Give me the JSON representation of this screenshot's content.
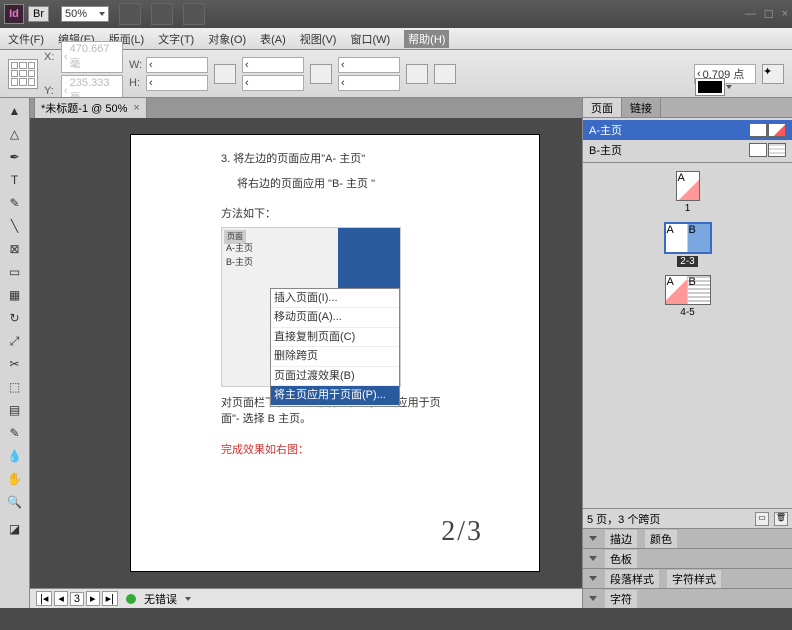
{
  "titlebar": {
    "app_abbr": "Id",
    "bridge": "Br",
    "zoom": "50%"
  },
  "menu": {
    "file": "文件(F)",
    "edit": "编辑(E)",
    "layout": "版面(L)",
    "type": "文字(T)",
    "object": "对象(O)",
    "table": "表(A)",
    "view": "视图(V)",
    "window": "窗口(W)",
    "help": "帮助(H)"
  },
  "ctrl": {
    "x_label": "X:",
    "y_label": "Y:",
    "w_label": "W:",
    "h_label": "H:",
    "x": "470.667 毫",
    "y": "235.333 毫",
    "stroke": "0.709 点"
  },
  "tab": {
    "name": "*未标题-1 @ 50%"
  },
  "doc": {
    "step_num": "3.",
    "step_line1": "将左边的页面应用\"A- 主页\"",
    "step_line2": "将右边的页面应用 \"B- 主页 \"",
    "method": "方法如下：",
    "desc1": "对页面栏下右边的页面右击 -\"将主页应用于页",
    "desc2": "面\"- 选择 B 主页。",
    "result": "完成效果如右图：",
    "pagenum": "2/3",
    "ss": {
      "a": "A-主页",
      "b": "B-主页",
      "m1": "插入页面(I)...",
      "m2": "移动页面(A)...",
      "m3": "直接复制页面(C)",
      "m4": "删除跨页",
      "m5": "页面过渡效果(B)",
      "m6": "将主页应用于页面(P)..."
    }
  },
  "status": {
    "page": "3",
    "errors": "无错误"
  },
  "panels": {
    "pages_tab": "页面",
    "links_tab": "链接",
    "master_a": "A-主页",
    "master_b": "B-主页",
    "spread1": "1",
    "spread2": "2-3",
    "spread3": "4-5",
    "foot": "5 页，3 个跨页",
    "stroke": "描边",
    "color": "颜色",
    "swatches": "色板",
    "para": "段落样式",
    "char": "字符样式",
    "chars": "字符"
  }
}
